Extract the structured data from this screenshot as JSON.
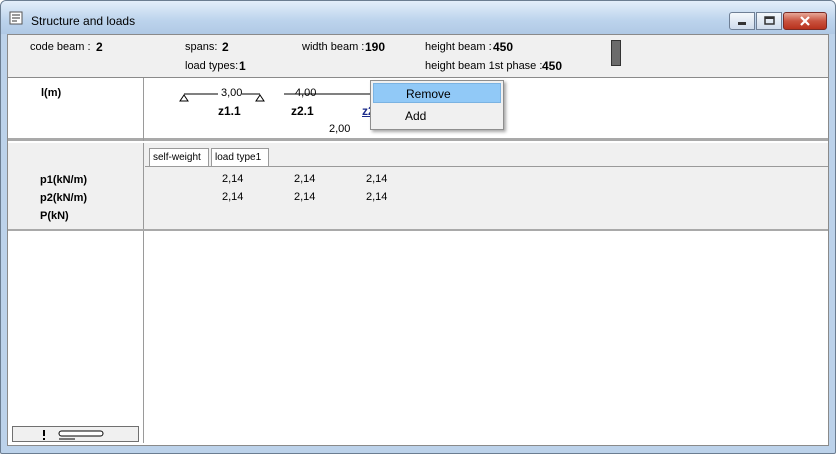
{
  "window": {
    "title": "Structure and loads"
  },
  "info": {
    "code_beam_label": "code beam :",
    "code_beam_value": "2",
    "spans_label": "spans:",
    "spans_value": "2",
    "load_types_label": "load types:",
    "load_types_value": "1",
    "width_beam_label": "width beam :",
    "width_beam_value": "190",
    "height_beam_label": "height beam :",
    "height_beam_value": "450",
    "height_beam_1st_label": "height beam 1st phase :",
    "height_beam_1st_value": "450"
  },
  "structure": {
    "row_label": "l(m)",
    "span1_length": "3,00",
    "span2_length": "4,00",
    "zone1": "z1.1",
    "zone2": "z2.1",
    "zone3": "z2.2",
    "sub_length": "2,00"
  },
  "context_menu": {
    "items": [
      "Remove",
      "Add"
    ],
    "highlighted": "Remove"
  },
  "loads": {
    "tabs": [
      "self-weight",
      "load type1"
    ],
    "active_tab": "self-weight",
    "row_labels": [
      "p1(kN/m)",
      "p2(kN/m)",
      "P(kN)"
    ],
    "p1": [
      "2,14",
      "2,14",
      "2,14"
    ],
    "p2": [
      "2,14",
      "2,14",
      "2,14"
    ]
  }
}
